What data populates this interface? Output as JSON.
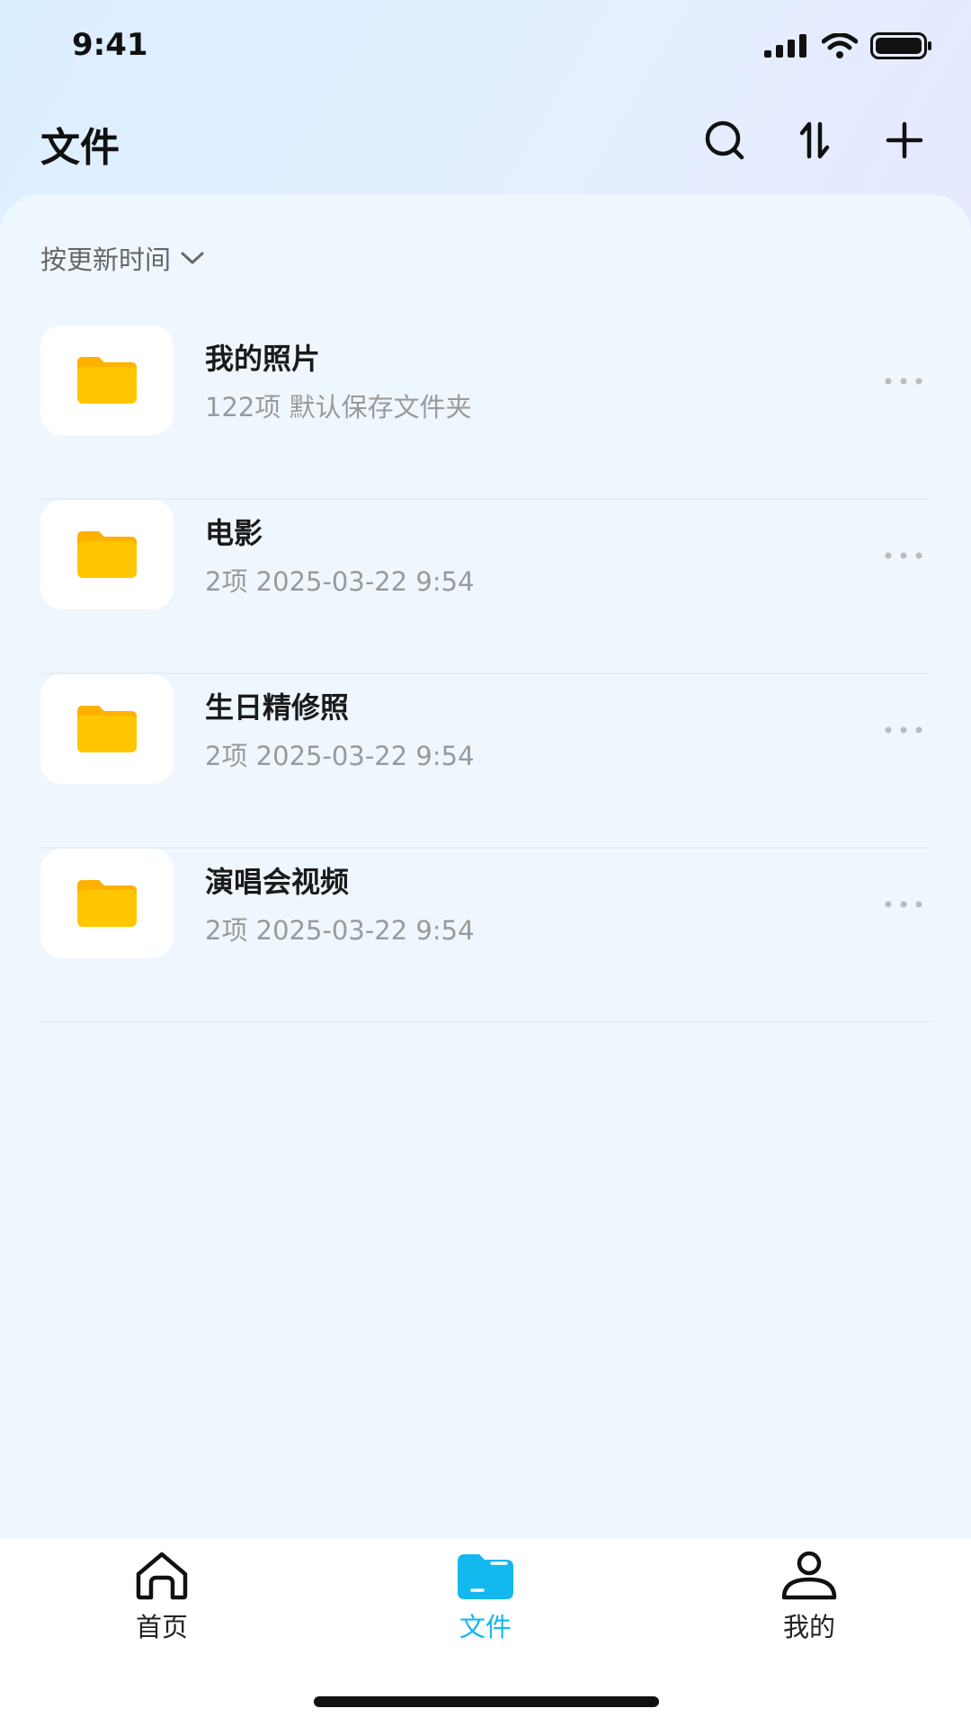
{
  "status_bar": {
    "time": "9:41"
  },
  "header": {
    "title": "文件",
    "icons": [
      "search-icon",
      "sort-icon",
      "add-icon"
    ]
  },
  "sort": {
    "label": "按更新时间"
  },
  "files": [
    {
      "name": "我的照片",
      "meta": "122项  默认保存文件夹"
    },
    {
      "name": "电影",
      "meta": "2项  2025-03-22 9:54"
    },
    {
      "name": "生日精修照",
      "meta": "2项  2025-03-22 9:54"
    },
    {
      "name": "演唱会视频",
      "meta": "2项  2025-03-22 9:54"
    }
  ],
  "tabs": [
    {
      "label": "首页",
      "icon": "home-icon",
      "active": false
    },
    {
      "label": "文件",
      "icon": "folder-icon",
      "active": true
    },
    {
      "label": "我的",
      "icon": "person-icon",
      "active": false
    }
  ],
  "colors": {
    "accent": "#12b8ee",
    "folder": "#ffc600",
    "folder_back": "#ffb100"
  }
}
